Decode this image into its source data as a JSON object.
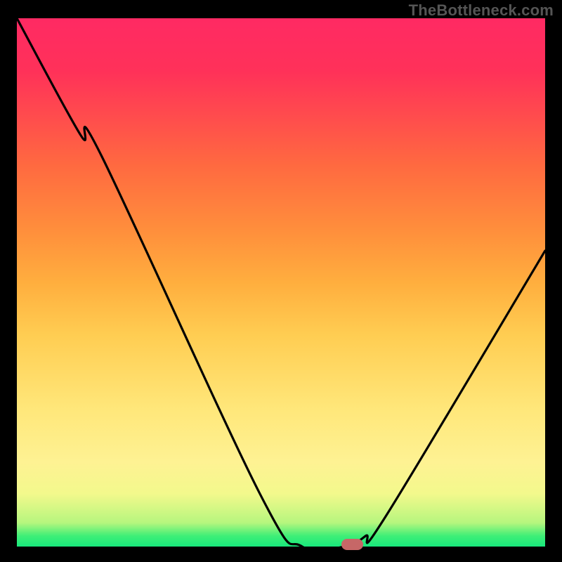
{
  "watermark": "TheBottleneck.com",
  "chart_data": {
    "type": "line",
    "title": "",
    "xlabel": "",
    "ylabel": "",
    "xlim": [
      0,
      100
    ],
    "ylim": [
      0,
      100
    ],
    "grid": false,
    "series": [
      {
        "name": "bottleneck-curve",
        "x": [
          0,
          12,
          16,
          46,
          54,
          62,
          66,
          70,
          100
        ],
        "values": [
          100,
          78,
          74,
          10,
          0,
          0,
          2,
          6,
          56
        ]
      }
    ],
    "marker": {
      "x": 63.5,
      "y": 0,
      "width": 4,
      "height": 2
    },
    "colors": {
      "background": "#000000",
      "curve": "#000000",
      "marker": "#c66767",
      "gradient_top": "#ff2a63",
      "gradient_bottom": "#18e87c"
    }
  }
}
